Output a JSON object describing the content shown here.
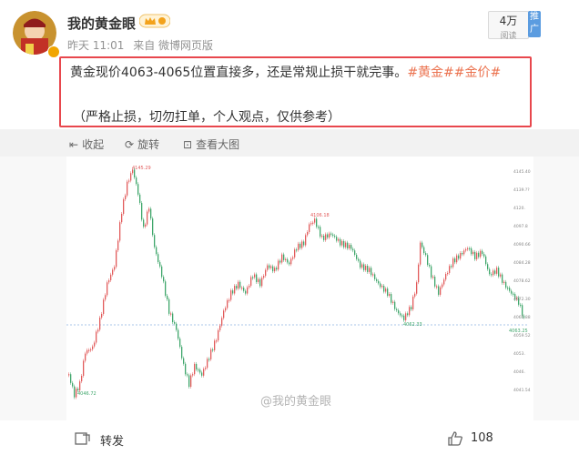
{
  "post": {
    "author": "我的黄金眼",
    "time": "昨天 11:01",
    "source": "来自 微博网页版",
    "text_main": "黄金现价4063-4065位置直接多，还是常规止损干就完事。",
    "tags": "#黄金##金价#",
    "text_note": "（严格止损，切勿扛单，个人观点，仅供参考）"
  },
  "follow_badge": {
    "count": "4万",
    "label": "阅读",
    "push": "推广"
  },
  "image_toolbar": {
    "collapse": "收起",
    "rotate": "旋转",
    "view_large": "查看大图"
  },
  "watermark": "@我的黄金眼",
  "actions": {
    "forward": "转发",
    "likes": "108"
  },
  "colors": {
    "accent": "#eb7350",
    "highlight_border": "#e8474d",
    "up": "#e25b5b",
    "down": "#3fa66b",
    "bg": "#f2f2f2"
  },
  "chart_data": {
    "type": "line",
    "title": "",
    "peak_label": "4145.29",
    "mid_label": "4106.18",
    "low_label": "4046.72",
    "right_low_label": "4062.33",
    "last_label": "4063.25",
    "y_ticks": [
      "4145.40",
      "4139.??",
      "4120.",
      "4097.8",
      "4090.66",
      "4084.28",
      "4078.62",
      "4072.30",
      "4065.88",
      "4059.52",
      "4053.",
      "4046.",
      "4041.54"
    ]
  }
}
